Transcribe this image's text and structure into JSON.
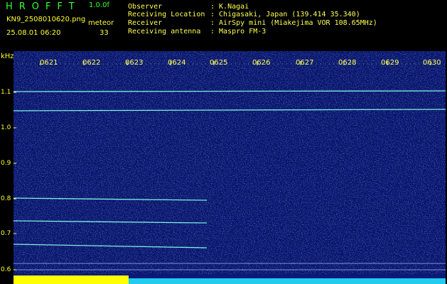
{
  "header": {
    "brand": "HROFFT",
    "version": "1.0.0f",
    "filename": "KN9_2508010620.png",
    "meteor_label": "meteor",
    "datetime": "25.08.01 06:20",
    "meteor_count": "33"
  },
  "meta": [
    {
      "key": "Observer",
      "value": ": K.Nagai"
    },
    {
      "key": "Receiving Location",
      "value": ": Chigasaki, Japan (139.414 35.340)"
    },
    {
      "key": "Receiver",
      "value": ": AirSpy mini (Miakejima VOR 108.65MHz)"
    },
    {
      "key": "Receiving antenna",
      "value": ": Maspro FM-3"
    }
  ],
  "axis": {
    "unit": "kHz",
    "y_ticks": [
      "1.1",
      "1.0",
      "0.9",
      "0.8",
      "0.7",
      "0.6"
    ],
    "time_ticks": [
      "0621",
      "0622",
      "0623",
      "0624",
      "0625",
      "0626",
      "0627",
      "0628",
      "0629",
      "0630"
    ]
  },
  "colors": {
    "background": "#08146a",
    "noise": "#2a54d8",
    "line": "#7ff0e0",
    "header_text": "#ffff55",
    "brand": "#33ff33"
  }
}
